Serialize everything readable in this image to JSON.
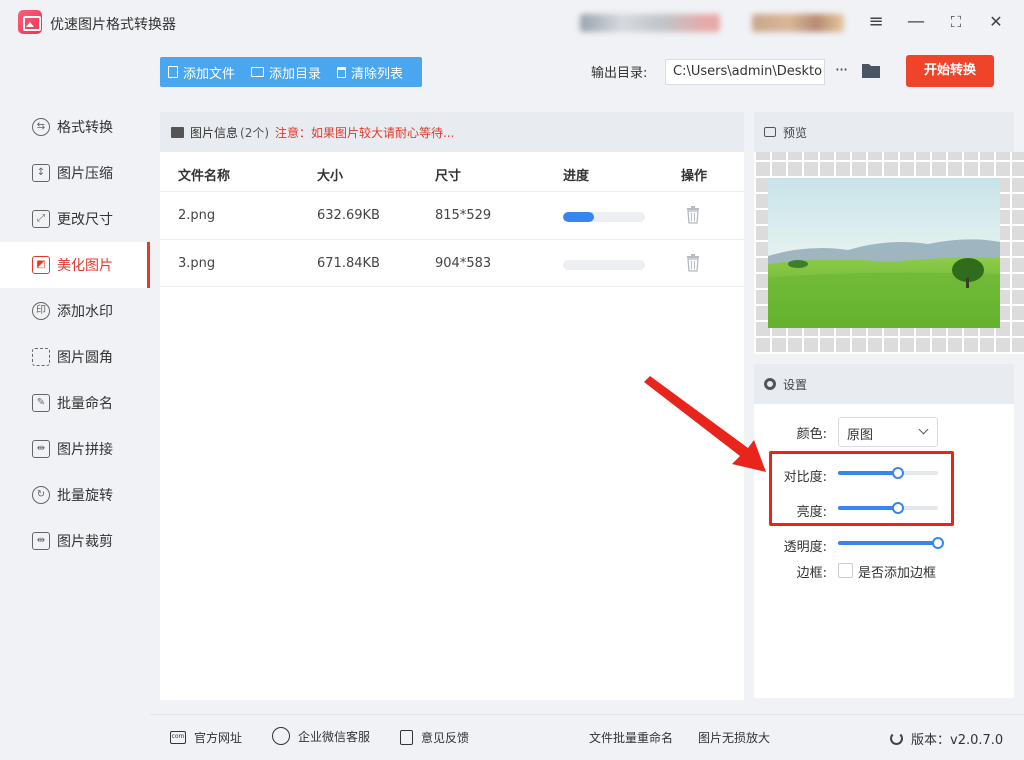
{
  "app": {
    "title": "优速图片格式转换器"
  },
  "window_controls": {
    "menu": "≡",
    "minimize": "—",
    "maximize": "⛶",
    "close": "✕"
  },
  "sidebar": {
    "items": [
      {
        "label": "格式转换",
        "icon": "format-convert-icon",
        "active": false
      },
      {
        "label": "图片压缩",
        "icon": "compress-icon",
        "active": false
      },
      {
        "label": "更改尺寸",
        "icon": "resize-icon",
        "active": false
      },
      {
        "label": "美化图片",
        "icon": "beautify-icon",
        "active": true
      },
      {
        "label": "添加水印",
        "icon": "watermark-icon",
        "active": false
      },
      {
        "label": "图片圆角",
        "icon": "rounded-corner-icon",
        "active": false
      },
      {
        "label": "批量命名",
        "icon": "rename-icon",
        "active": false
      },
      {
        "label": "图片拼接",
        "icon": "stitch-icon",
        "active": false
      },
      {
        "label": "批量旋转",
        "icon": "rotate-icon",
        "active": false
      },
      {
        "label": "图片裁剪",
        "icon": "crop-icon",
        "active": false
      }
    ]
  },
  "toolbar": {
    "add_file": "添加文件",
    "add_dir": "添加目录",
    "clear_list": "清除列表",
    "output_label": "输出目录:",
    "output_path": "C:\\Users\\admin\\Deskto",
    "more": "···",
    "start": "开始转换"
  },
  "file_panel": {
    "header": "图片信息",
    "count": "(2个)",
    "warning": "注意：如果图片较大请耐心等待...",
    "columns": [
      "文件名称",
      "大小",
      "尺寸",
      "进度",
      "操作"
    ],
    "rows": [
      {
        "name": "2.png",
        "size": "632.69KB",
        "dims": "815*529",
        "progress": 0.38
      },
      {
        "name": "3.png",
        "size": "671.84KB",
        "dims": "904*583",
        "progress": 0
      }
    ]
  },
  "preview": {
    "header": "预览"
  },
  "settings": {
    "header": "设置",
    "color_label": "颜色:",
    "color_value": "原图",
    "contrast_label": "对比度:",
    "contrast_value": 0.6,
    "brightness_label": "亮度:",
    "brightness_value": 0.6,
    "opacity_label": "透明度:",
    "opacity_value": 1.0,
    "border_label": "边框:",
    "border_checkbox": "是否添加边框"
  },
  "footer": {
    "website": "官方网址",
    "wechat": "企业微信客服",
    "feedback": "意见反馈",
    "batch_rename": "文件批量重命名",
    "upscale": "图片无损放大",
    "version": "版本：v2.0.7.0"
  },
  "colors": {
    "accent": "#3786f0",
    "danger": "#e4392b",
    "start_button": "#f0442a",
    "toolbar": "#4aa6ee"
  }
}
